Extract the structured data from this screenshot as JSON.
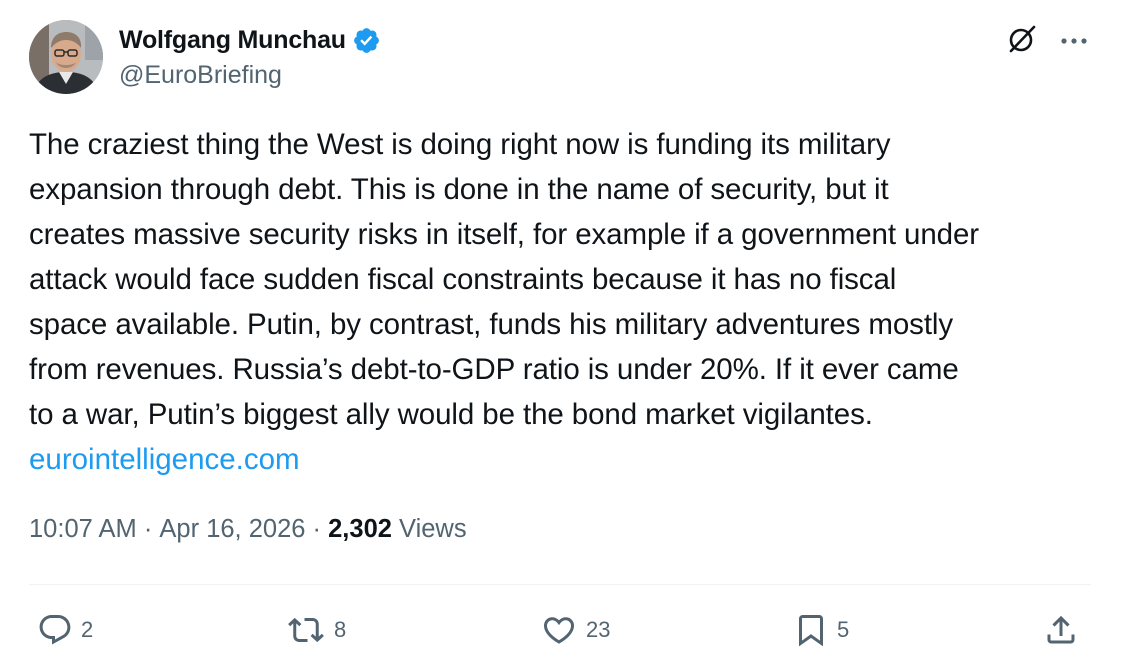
{
  "author": {
    "display_name": "Wolfgang Munchau",
    "handle": "@EuroBriefing",
    "verified": true
  },
  "tweet": {
    "text": "The craziest thing the West is doing right now is funding its military\nexpansion through debt. This is done in the name of security, but it\ncreates massive security risks in itself, for example if a government under\nattack would face sudden fiscal constraints because it has no fiscal\nspace available. Putin, by contrast, funds his military adventures mostly\nfrom revenues. Russia’s debt-to-GDP ratio is under 20%. If it ever came\nto a war, Putin’s biggest ally would be the bond market vigilantes.",
    "link": "eurointelligence.com",
    "time": "10:07 AM",
    "separator": " · ",
    "date": "Apr 16, 2026",
    "views_count": "2,302",
    "views_label": " Views"
  },
  "actions": {
    "replies": "2",
    "reposts": "8",
    "likes": "23",
    "bookmarks": "5"
  },
  "icons": {
    "verified": "verified-badge-icon",
    "grok": "grok-icon",
    "more": "more-icon",
    "reply": "reply-icon",
    "repost": "repost-icon",
    "like": "heart-icon",
    "bookmark": "bookmark-icon",
    "share": "share-icon"
  },
  "colors": {
    "text": "#0f1419",
    "secondary": "#536471",
    "link": "#1d9bf0",
    "verified": "#1d9bf0",
    "divider": "#eff3f4"
  }
}
